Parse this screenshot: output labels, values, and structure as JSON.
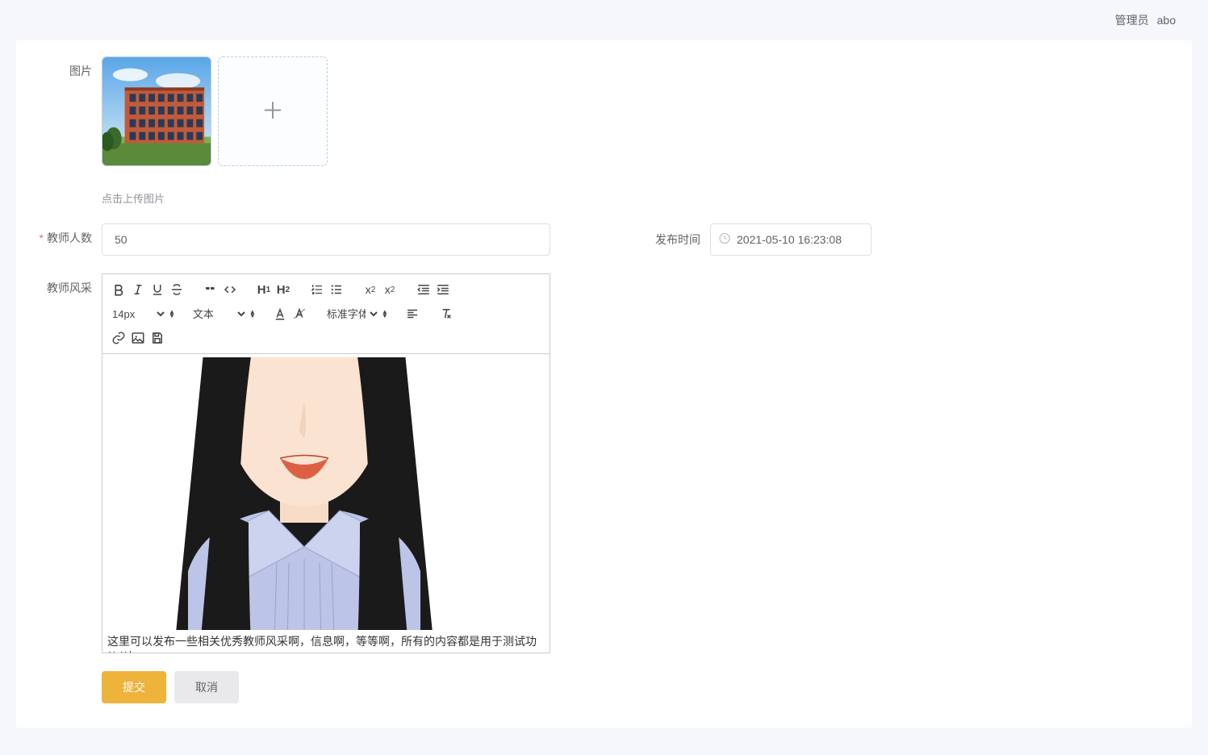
{
  "header": {
    "role": "管理员",
    "username": "abo"
  },
  "form": {
    "image_label": "图片",
    "upload_hint": "点击上传图片",
    "teacher_count_label": "教师人数",
    "teacher_count_value": "50",
    "publish_time_label": "发布时间",
    "publish_time_value": "2021-05-10 16:23:08",
    "teacher_style_label": "教师风采"
  },
  "editor": {
    "font_size": "14px",
    "text_type": "文本",
    "font_family": "标准字体",
    "content_text": "这里可以发布一些相关优秀教师风采啊，信息啊，等等啊，所有的内容都是用于测试功能的"
  },
  "buttons": {
    "submit": "提交",
    "cancel": "取消"
  }
}
